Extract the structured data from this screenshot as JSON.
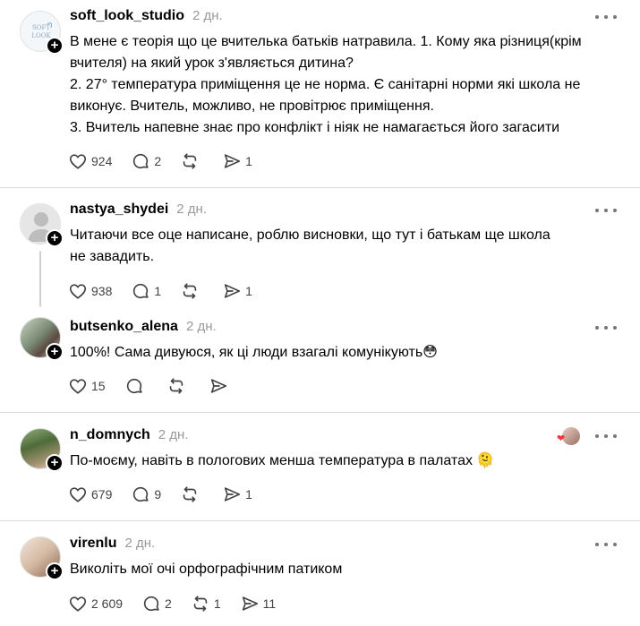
{
  "colors": {
    "accent_like": "#ff3040",
    "muted": "#999999",
    "divider": "#dbdbdb"
  },
  "posts": [
    {
      "username": "soft_look_studio",
      "time": "2 дн.",
      "avatar_icon": "soft-look-logo-avatar",
      "avatar_text": "SOFT LOOK",
      "text_lines": [
        "В мене є теорія що це вчителька батьків натравила. 1. Кому яка різниця(крім",
        "вчителя) на який урок з'являється дитина?",
        "2. 27° температура приміщення це не норма. Є санітарні норми які школа не",
        "виконує. Вчитель, можливо, не провітрює приміщення.",
        "3. Вчитель напевне знає про конфлікт і ніяк не намагається його загасити"
      ],
      "likes": "924",
      "replies": "2",
      "reposts": "",
      "shares": "1"
    },
    {
      "username": "nastya_shydei",
      "time": "2 дн.",
      "avatar_icon": "default-user-avatar",
      "text_lines": [
        "Читаючи все оце написане, роблю висновки, що тут і батькам ще школа",
        "не завадить."
      ],
      "likes": "938",
      "replies": "1",
      "reposts": "",
      "shares": "1"
    },
    {
      "username": "butsenko_alena",
      "time": "2 дн.",
      "avatar_icon": "photo-avatar",
      "text_lines": [
        "100%! Сама дивуюся, як ці люди взагалі комунікують😳"
      ],
      "likes": "15",
      "replies": "",
      "reposts": "",
      "shares": ""
    },
    {
      "username": "n_domnych",
      "time": "2 дн.",
      "avatar_icon": "nature-photo-avatar",
      "text_lines": [
        "По-моєму, навіть в пологових менша температура в палатах 🫠"
      ],
      "likes": "679",
      "replies": "9",
      "reposts": "",
      "shares": "1",
      "liked_by_author": true
    },
    {
      "username": "virenlu",
      "time": "2 дн.",
      "avatar_icon": "portrait-avatar",
      "text_lines": [
        "Виколіть мої очі орфографічним патиком"
      ],
      "likes": "2 609",
      "replies": "2",
      "reposts": "1",
      "shares": "11"
    }
  ]
}
